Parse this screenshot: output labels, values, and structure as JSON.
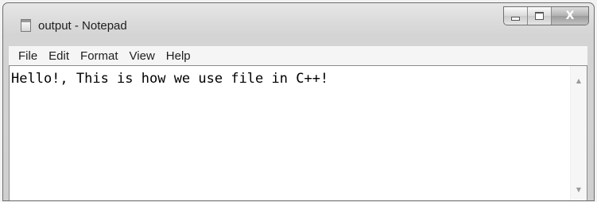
{
  "window": {
    "title": "output - Notepad",
    "icon": "notepad-icon"
  },
  "controls": {
    "minimize_icon": "minimize-icon",
    "maximize_icon": "maximize-icon",
    "close_glyph": "X"
  },
  "menubar": {
    "items": [
      "File",
      "Edit",
      "Format",
      "View",
      "Help"
    ]
  },
  "editor": {
    "content": "Hello!, This is how we use file in C++!"
  },
  "scrollbar": {
    "up_glyph": "▲",
    "down_glyph": "▼"
  }
}
